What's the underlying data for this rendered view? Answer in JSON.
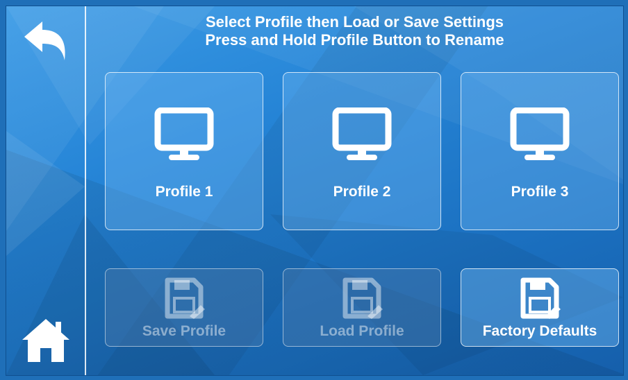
{
  "header": {
    "line1": "Select Profile then Load or Save Settings",
    "line2": "Press and Hold Profile Button to Rename"
  },
  "nav": {
    "back_icon": "back-arrow-icon",
    "home_icon": "home-icon"
  },
  "profiles": [
    {
      "label": "Profile 1",
      "icon": "monitor-icon"
    },
    {
      "label": "Profile 2",
      "icon": "monitor-icon"
    },
    {
      "label": "Profile 3",
      "icon": "monitor-icon"
    }
  ],
  "actions": [
    {
      "label": "Save Profile",
      "icon": "floppy-disk-icon",
      "enabled": false
    },
    {
      "label": "Load Profile",
      "icon": "floppy-disk-icon",
      "enabled": false
    },
    {
      "label": "Factory Defaults",
      "icon": "floppy-disk-icon",
      "enabled": true
    }
  ],
  "colors": {
    "background": "#2584d6",
    "text": "#ffffff"
  }
}
